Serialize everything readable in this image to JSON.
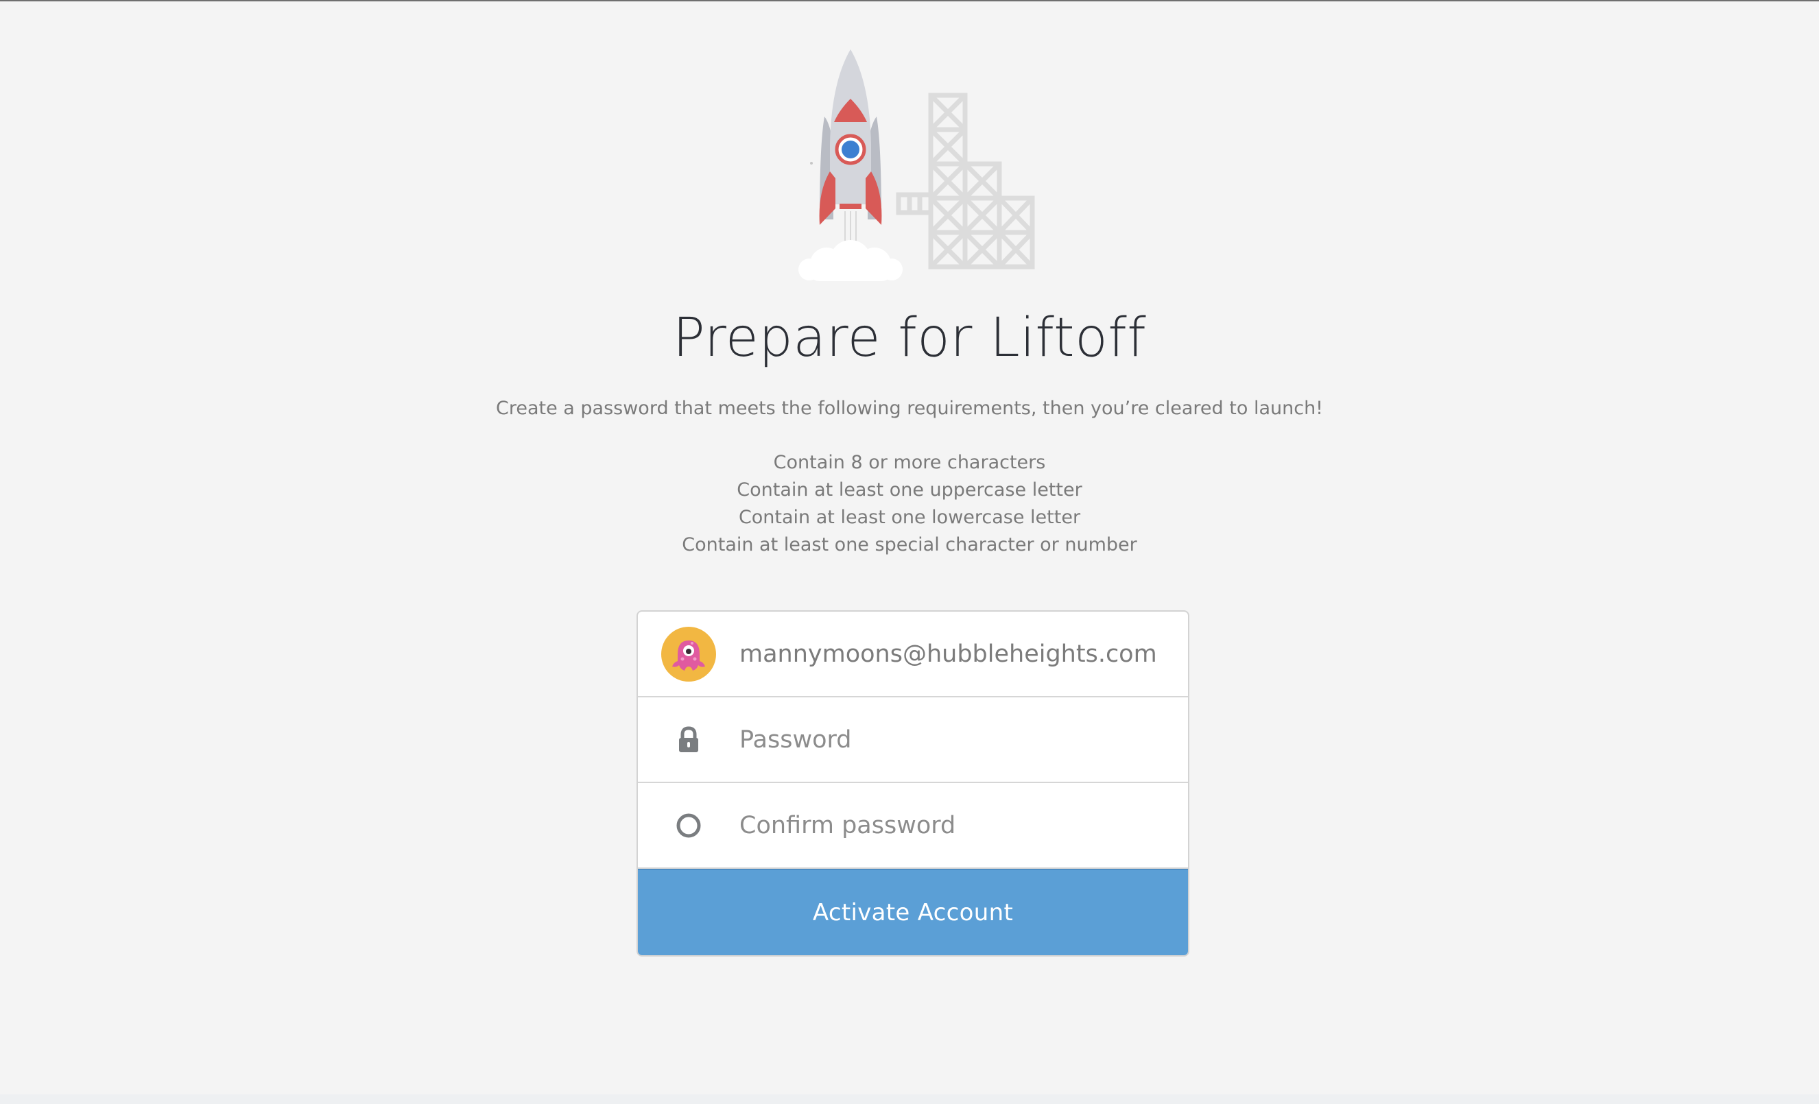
{
  "page": {
    "title": "Prepare for Liftoff",
    "subtitle": "Create a password that meets the following requirements, then you’re cleared to launch!"
  },
  "requirements": [
    "Contain 8 or more characters",
    "Contain at least one uppercase letter",
    "Contain at least one lowercase letter",
    "Contain at least one special character or number"
  ],
  "form": {
    "email": "mannymoons@hubbleheights.com",
    "password_placeholder": "Password",
    "confirm_placeholder": "Confirm password",
    "submit_label": "Activate Account"
  },
  "icons": {
    "hero": "rocket-launch-illustration",
    "avatar": "pink-octopus-avatar",
    "password": "lock-icon",
    "confirm": "circle-status-icon"
  },
  "colors": {
    "background": "#f4f4f4",
    "button": "#5b9fd6",
    "avatar_bg": "#f2b742",
    "octopus": "#e05aa0",
    "rocket_red": "#d85a57",
    "rocket_body": "#d4d6dc"
  }
}
